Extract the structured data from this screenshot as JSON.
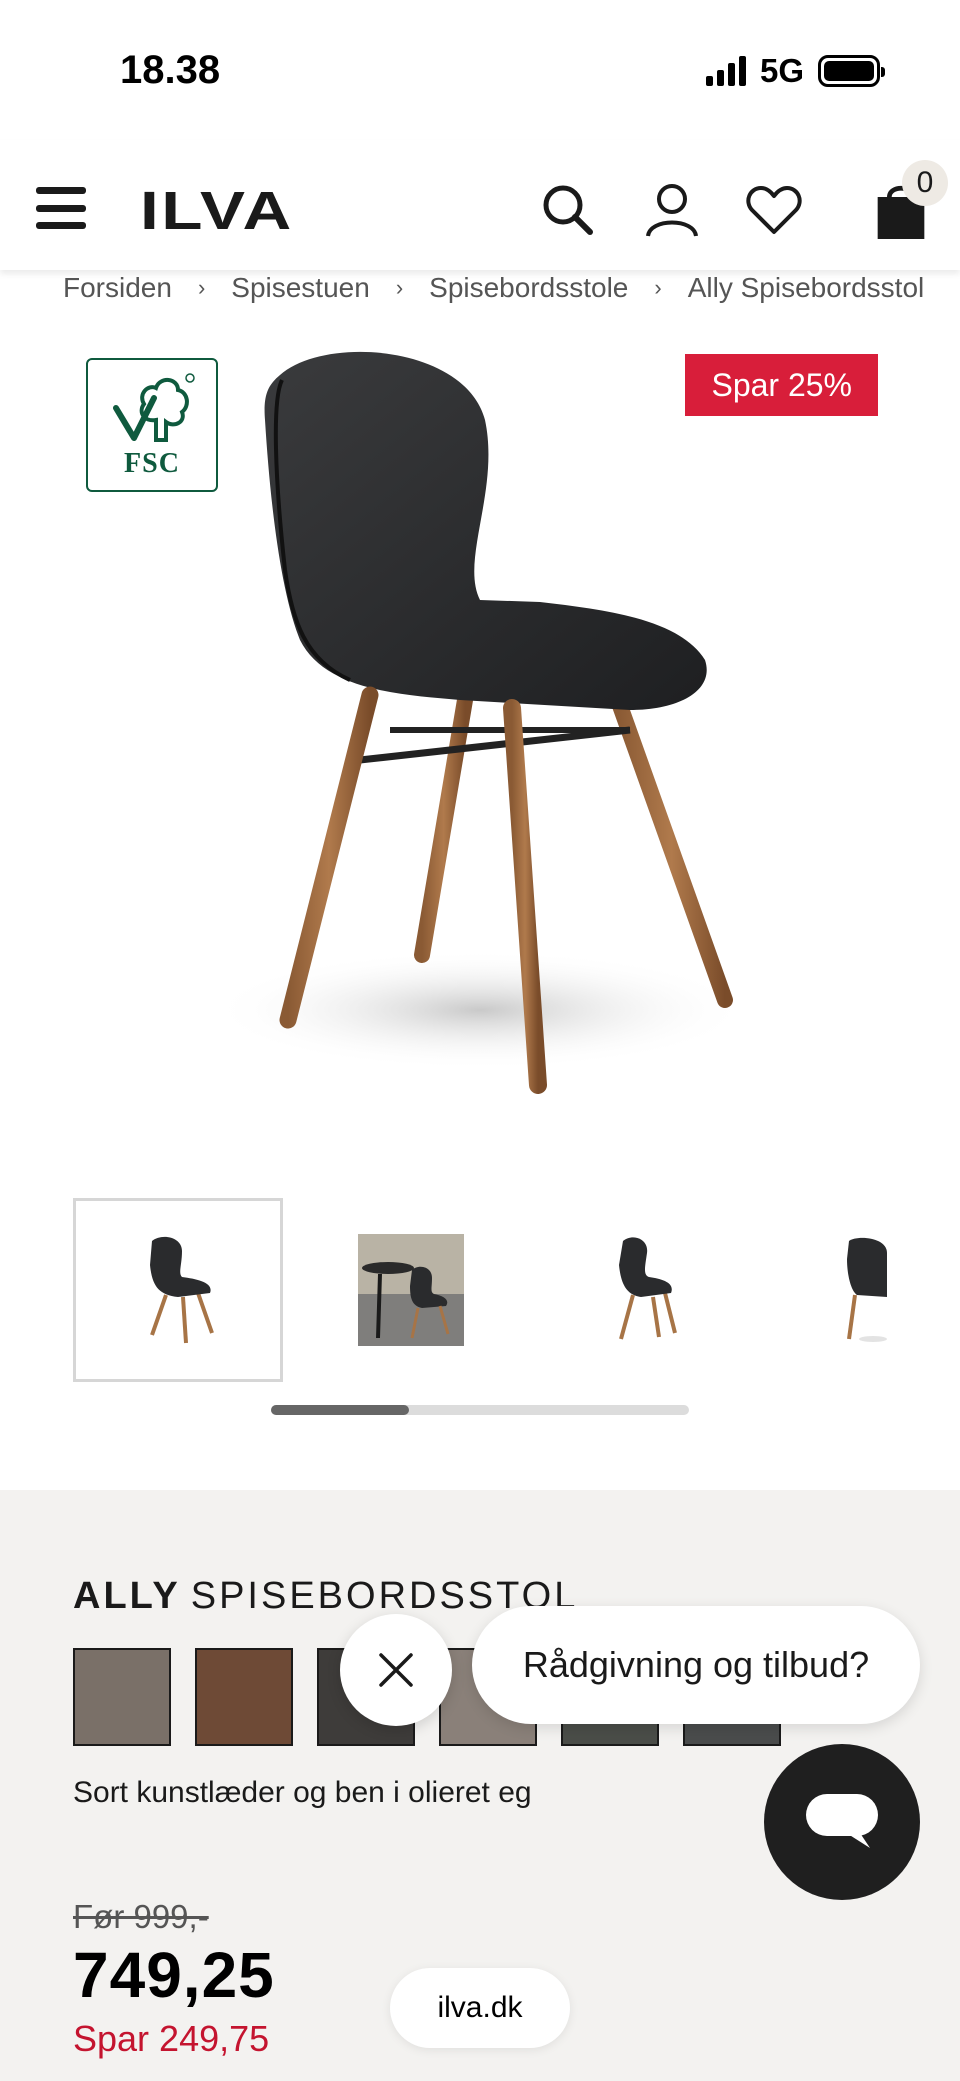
{
  "status_bar": {
    "time": "18.38",
    "network": "5G"
  },
  "header": {
    "logo": "ILVA",
    "cart_count": "0",
    "icons": [
      "menu-icon",
      "search-icon",
      "user-icon",
      "heart-icon",
      "shopping-bag-icon"
    ]
  },
  "breadcrumb": [
    {
      "label": "Forsiden"
    },
    {
      "label": "Spisestuen"
    },
    {
      "label": "Spisebordsstole"
    },
    {
      "label": "Ally Spisebordsstol"
    }
  ],
  "badges": {
    "fsc": "FSC",
    "sale": "Spar 25%"
  },
  "gallery": {
    "thumbnails": 4,
    "active_index": 0,
    "scroll_position": 0.33
  },
  "product": {
    "brand": "ALLY",
    "name": "SPISEBORDSSTOL",
    "variant_description": "Sort kunstlæder og ben i olieret eg",
    "swatch_colors": [
      "#7a7068",
      "#6e4a36",
      "#3e3c3a",
      "#8a8079",
      "#4a4d48",
      "#4a4c4c"
    ],
    "price_before": "Før 999,-",
    "price_now": "749,25",
    "price_saving": "Spar 249,75"
  },
  "chat": {
    "prompt": "Rådgivning og tilbud?"
  },
  "browser": {
    "url": "ilva.dk"
  },
  "colors": {
    "sale_red": "#d81e3a",
    "fsc_green": "#0f5a3e",
    "details_bg": "#f3f2f0"
  }
}
